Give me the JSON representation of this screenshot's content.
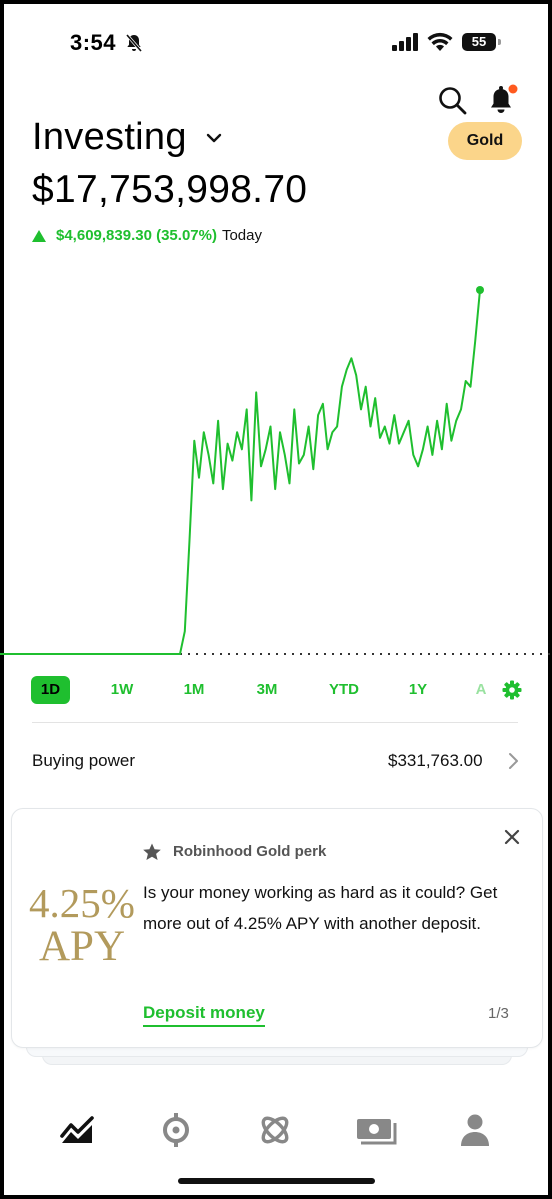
{
  "status_bar": {
    "time": "3:54",
    "battery": "55",
    "icons": [
      "bell-slash-icon",
      "signal-icon",
      "wifi-icon",
      "battery-icon"
    ]
  },
  "header": {
    "title": "Investing",
    "gold_badge": "Gold",
    "icons": [
      "search-icon",
      "bell-icon",
      "chevron-down-icon"
    ],
    "notification_dot_color": "#ff5a1f"
  },
  "portfolio": {
    "value": "$17,753,998.70",
    "change": "$4,609,839.30 (35.07%)",
    "period": "Today",
    "trend_color": "#1fbf2f"
  },
  "chart_data": {
    "type": "line",
    "series": [
      {
        "values": [
          0,
          0,
          0,
          0,
          0,
          0,
          0,
          0,
          0,
          0,
          0,
          0,
          0,
          0,
          0,
          0,
          0,
          0,
          0,
          0,
          0,
          0,
          0,
          0,
          0,
          0,
          0,
          0,
          0,
          0,
          0,
          0,
          0,
          0,
          0,
          0,
          0,
          0,
          0,
          0,
          0,
          0,
          0,
          0,
          0,
          8,
          40,
          75,
          62,
          78,
          70,
          60,
          82,
          58,
          74,
          68,
          78,
          72,
          86,
          54,
          92,
          66,
          72,
          80,
          58,
          78,
          70,
          60,
          86,
          67,
          70,
          80,
          65,
          84,
          88,
          72,
          78,
          80,
          94,
          100,
          104,
          98,
          86,
          94,
          80,
          90,
          76,
          80,
          74,
          84,
          74,
          78,
          82,
          70,
          66,
          72,
          80,
          70,
          82,
          72,
          88,
          75,
          82,
          86,
          96,
          94,
          110,
          128
        ],
        "color": "#1fbf2f"
      }
    ],
    "baseline": "dotted",
    "grid": false,
    "legend": "none"
  },
  "ranges": {
    "items": [
      "1D",
      "1W",
      "1M",
      "3M",
      "YTD",
      "1Y",
      "A"
    ],
    "active": "1D",
    "settings_icon": "gear-icon"
  },
  "buying_power": {
    "label": "Buying power",
    "value": "$331,763.00"
  },
  "promo": {
    "apy_percent": "4.25%",
    "apy_label": "APY",
    "perk_label": "Robinhood Gold perk",
    "body": "Is your money working as hard as it could? Get more out of 4.25% APY with another deposit.",
    "cta": "Deposit money",
    "page": "1/3"
  },
  "bottom_nav": {
    "items": [
      "investing-icon",
      "crypto-icon",
      "ai-icon",
      "cash-icon",
      "account-icon"
    ],
    "active": "investing-icon"
  }
}
